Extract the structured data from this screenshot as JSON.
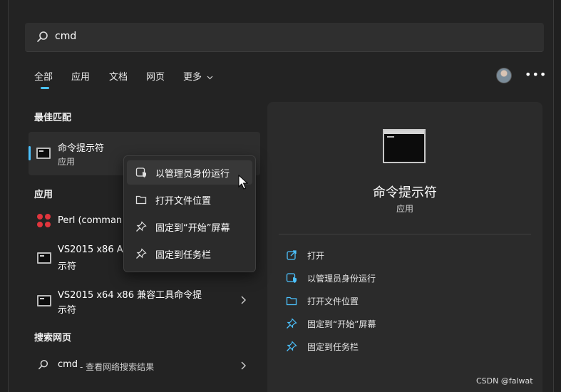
{
  "search": {
    "query": "cmd"
  },
  "filters": [
    {
      "label": "全部",
      "active": true
    },
    {
      "label": "应用"
    },
    {
      "label": "文档"
    },
    {
      "label": "网页"
    },
    {
      "label": "更多"
    }
  ],
  "sections": {
    "best_match": "最佳匹配",
    "apps": "应用",
    "web": "搜索网页"
  },
  "best_match": {
    "title": "命令提示符",
    "subtitle": "应用"
  },
  "apps": [
    {
      "title": "Perl (comman"
    },
    {
      "line1": "VS2015 x86 A",
      "line2": "示符"
    },
    {
      "line1": "VS2015 x64 x86 兼容工具命令提",
      "line2": "示符"
    }
  ],
  "web_result": {
    "query": "cmd",
    "suffix": " - 查看网络搜索结果"
  },
  "context_menu": [
    {
      "label": "以管理员身份运行",
      "icon": "shield-icon"
    },
    {
      "label": "打开文件位置",
      "icon": "folder-icon"
    },
    {
      "label": "固定到“开始”屏幕",
      "icon": "pin-icon"
    },
    {
      "label": "固定到任务栏",
      "icon": "pin-icon"
    }
  ],
  "preview": {
    "title": "命令提示符",
    "subtitle": "应用",
    "actions": [
      {
        "label": "打开",
        "icon": "open-icon"
      },
      {
        "label": "以管理员身份运行",
        "icon": "shield-icon"
      },
      {
        "label": "打开文件位置",
        "icon": "folder-icon"
      },
      {
        "label": "固定到“开始”屏幕",
        "icon": "pin-icon"
      },
      {
        "label": "固定到任务栏",
        "icon": "pin-icon"
      }
    ]
  },
  "watermark": "CSDN @falwat",
  "colors": {
    "accent": "#4cc2ff",
    "perl_red": "#e0353d"
  }
}
